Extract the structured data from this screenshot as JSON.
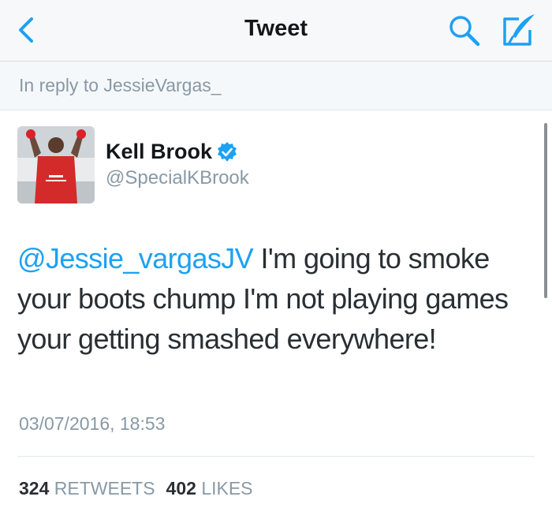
{
  "navbar": {
    "title": "Tweet",
    "back_icon": "chevron-left-icon",
    "search_icon": "search-icon",
    "compose_icon": "compose-icon"
  },
  "reply_context": "In reply to JessieVargas_",
  "tweet": {
    "author_name": "Kell Brook",
    "author_handle": "@SpecialKBrook",
    "verified": true,
    "mention": "@Jessie_vargasJV",
    "body": " I'm going to smoke your boots chump I'm not playing games your getting smashed everywhere!",
    "timestamp": "03/07/2016, 18:53",
    "retweets_count": "324",
    "retweets_label": "RETWEETS",
    "likes_count": "402",
    "likes_label": "LIKES"
  },
  "colors": {
    "accent": "#1da1f2",
    "muted_text": "#8899a6",
    "primary_text": "#292f33"
  }
}
